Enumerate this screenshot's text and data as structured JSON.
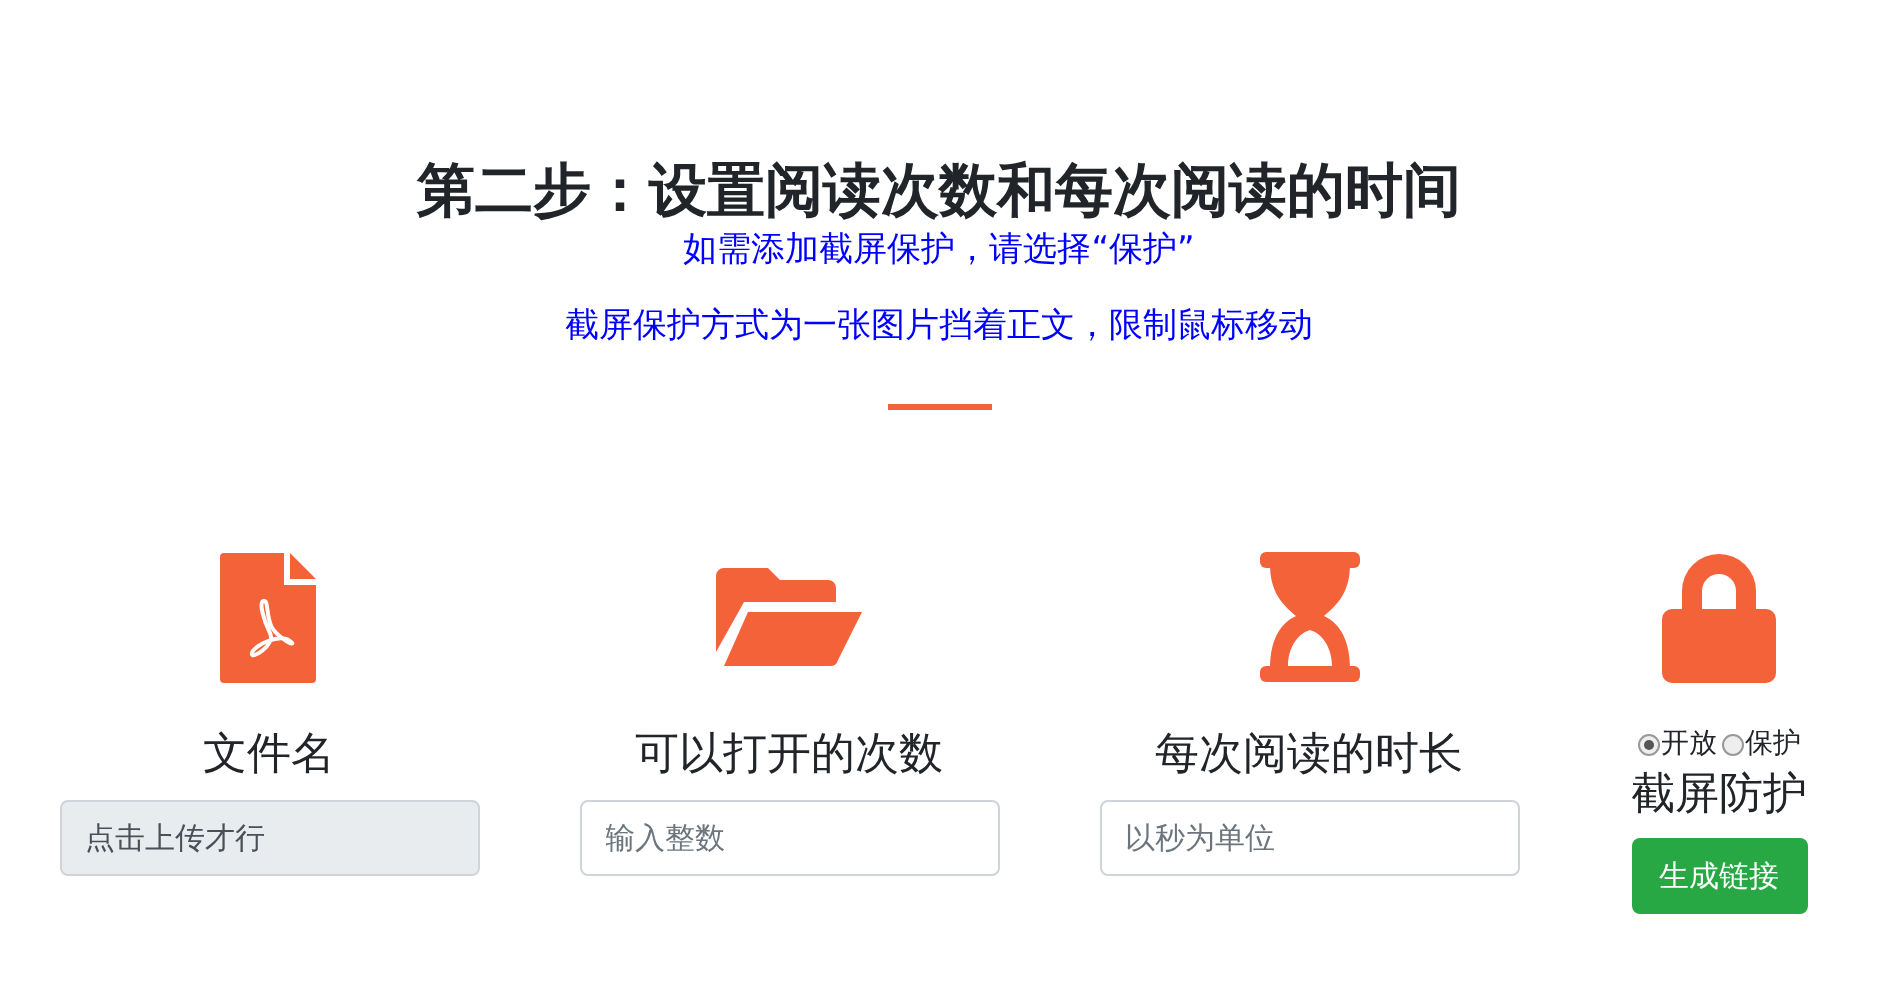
{
  "heading": "第二步：设置阅读次数和每次阅读的时间",
  "notes": [
    "如需添加截屏保护，请选择“保护”",
    "截屏保护方式为一张图片挡着正文，限制鼠标移动"
  ],
  "columns": [
    {
      "kind": "input",
      "label": "文件名",
      "field": {
        "placeholder": "点击上传才行",
        "disabled": true
      }
    },
    {
      "kind": "input",
      "label": "可以打开的次数",
      "field": {
        "placeholder": "输入整数",
        "disabled": false
      }
    },
    {
      "kind": "input",
      "label": "每次阅读的时长",
      "field": {
        "placeholder": "以秒为单位",
        "disabled": false
      }
    },
    {
      "kind": "radios",
      "options": [
        {
          "label": "开放",
          "selected": true
        },
        {
          "label": "保护",
          "selected": false
        }
      ],
      "label": "截屏防护",
      "button": "生成链接"
    }
  ]
}
